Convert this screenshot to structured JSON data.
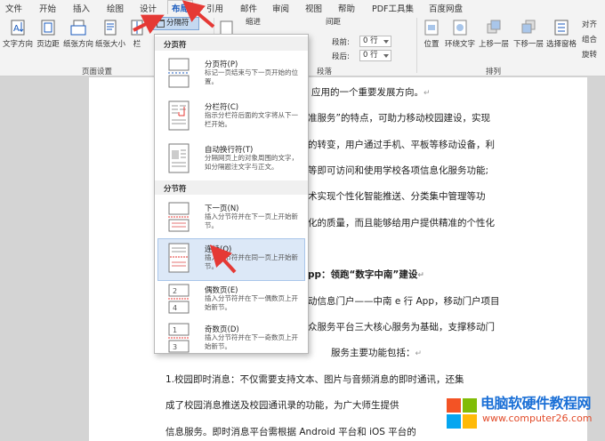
{
  "tabs": [
    "文件",
    "开始",
    "插入",
    "绘图",
    "设计",
    "布局",
    "引用",
    "邮件",
    "审阅",
    "视图",
    "帮助",
    "PDF工具集",
    "百度网盘"
  ],
  "active_tab": "布局",
  "ribbon": {
    "page_setup": {
      "buttons": [
        "文字方向",
        "页边距",
        "纸张方向",
        "纸张大小",
        "栏"
      ],
      "label": "页面设置",
      "breaks_button": "分隔符"
    },
    "indent_label": "缩进",
    "spacing_label": "间距",
    "before_label": "段前:",
    "before_value": "0 行",
    "after_label": "段后:",
    "after_value": "0 行",
    "paragraph_label": "段落",
    "arrange": {
      "buttons": [
        "位置",
        "环绕文字",
        "上移一层",
        "下移一层",
        "选择窗格"
      ],
      "side": [
        "对齐",
        "组合",
        "旋转"
      ],
      "label": "排列"
    }
  },
  "menu": {
    "page_breaks_header": "分页符",
    "section_breaks_header": "分节符",
    "items": [
      {
        "title": "分页符(P)",
        "desc": "标记一页结束与下一页开始的位置。"
      },
      {
        "title": "分栏符(C)",
        "desc": "指示分栏符后面的文字将从下一栏开始。"
      },
      {
        "title": "自动换行符(T)",
        "desc": "分隔网页上的对象周围的文字，如分隔题注文字与正文。"
      },
      {
        "title": "下一页(N)",
        "desc": "插入分节符并在下一页上开始新节。"
      },
      {
        "title": "连续(O)",
        "desc": "插入分节符并在同一页上开始新节。"
      },
      {
        "title": "偶数页(E)",
        "desc": "插入分节符并在下一偶数页上开始新节。"
      },
      {
        "title": "奇数页(D)",
        "desc": "插入分节符并在下一奇数页上开始新节。"
      }
    ]
  },
  "document": {
    "lines": [
      "应用的一个重要发展方向。",
      "准服务”的特点，可助力移动校园建设，实现",
      "的转变，用户通过手机、平板等移动设备，利",
      "等即可访问和使用学校各项信息化服务功能;",
      "术实现个性化智能推送、分类集中管理等功",
      "化的质量，而且能够给用户提供精准的个性化",
      "pp：领跑“数字中南”建设",
      "动信息门户——中南 e 行 App，移动门户项目",
      "众服务平台三大核心服务为基础，支撑移动门",
      "服务主要功能包括：",
      "1.校园即时消息：不仅需要支持文本、图片与音频消息的即时通讯，还集",
      "成了校园消息推送及校园通讯录的功能，为广大师生提供",
      "信息服务。即时消息平台需根据 Android 平台和 iOS 平台的"
    ],
    "para_mark": "↵"
  },
  "watermark": {
    "title": "电脑软硬件教程网",
    "url": "www.computer26.com"
  },
  "colors": {
    "accent": "#185abd",
    "arrow": "#e53935",
    "hover": "#dce8f7"
  }
}
